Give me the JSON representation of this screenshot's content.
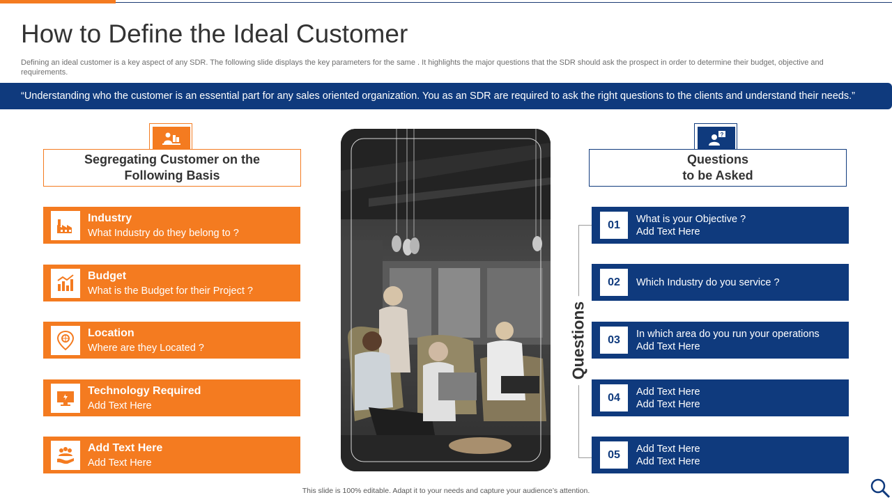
{
  "slide": {
    "title": "How to Define the Ideal Customer",
    "subtitle": "Defining an ideal customer is a key aspect of any SDR. The following slide displays the key parameters for the same . It highlights the major questions that the SDR should ask the prospect in order to  determine their budget, objective and requirements.",
    "quote": "“Understanding who the customer is an essential part for any sales oriented organization. You as an SDR are required to ask the right questions to the clients  and understand their needs.”",
    "footer": "This slide is 100% editable. Adapt it to your needs and capture your audience’s attention."
  },
  "left_panel": {
    "header_line1": "Segregating Customer on the",
    "header_line2": "Following Basis",
    "header_icon": "group-icon",
    "items": [
      {
        "title": "Industry",
        "text": "What Industry do they belong to ?",
        "icon": "factory-icon"
      },
      {
        "title": "Budget",
        "text": "What is the Budget for their Project ?",
        "icon": "budget-chart-icon"
      },
      {
        "title": "Location",
        "text": "Where are they Located ?",
        "icon": "location-pin-icon"
      },
      {
        "title": "Technology Required",
        "text": "Add Text Here",
        "icon": "monitor-icon"
      },
      {
        "title": "Add  Text Here",
        "text": "Add Text Here",
        "icon": "team-hand-icon"
      }
    ]
  },
  "right_panel": {
    "header_line1": "Questions",
    "header_line2": "to be Asked",
    "header_icon": "person-question-icon",
    "side_label": "Questions",
    "items": [
      {
        "num": "01",
        "line1": "What is your Objective ?",
        "line2": "Add Text Here"
      },
      {
        "num": "02",
        "line1": "Which Industry do you service ?",
        "line2": ""
      },
      {
        "num": "03",
        "line1": "In which area do you run your operations",
        "line2": "Add Text Here"
      },
      {
        "num": "04",
        "line1": "Add Text Here",
        "line2": "Add Text Here"
      },
      {
        "num": "05",
        "line1": "Add Text Here",
        "line2": "Add Text Here"
      }
    ]
  },
  "colors": {
    "accent_orange": "#f47b20",
    "accent_blue": "#0f3a7d"
  }
}
